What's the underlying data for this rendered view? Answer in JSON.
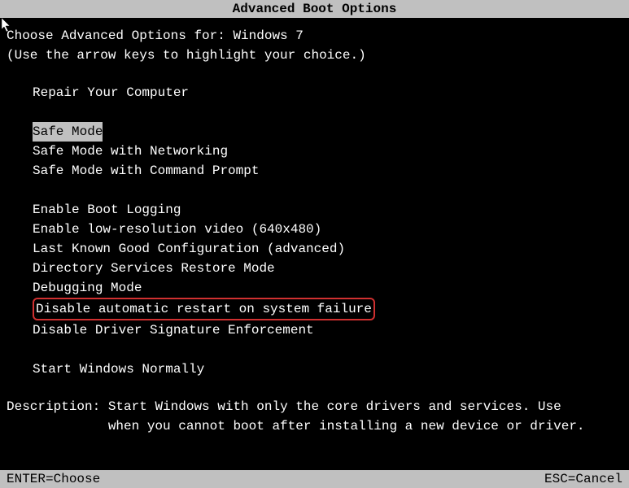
{
  "title": "Advanced Boot Options",
  "instruction1": "Choose Advanced Options for: Windows 7",
  "instruction2": "(Use the arrow keys to highlight your choice.)",
  "menu": {
    "repair": "Repair Your Computer",
    "safe_mode": "Safe Mode",
    "safe_mode_net": "Safe Mode with Networking",
    "safe_mode_cmd": "Safe Mode with Command Prompt",
    "boot_logging": "Enable Boot Logging",
    "low_res": "Enable low-resolution video (640x480)",
    "last_known": "Last Known Good Configuration (advanced)",
    "ds_restore": "Directory Services Restore Mode",
    "debugging": "Debugging Mode",
    "disable_restart": "Disable automatic restart on system failure",
    "disable_sig": "Disable Driver Signature Enforcement",
    "start_normal": "Start Windows Normally"
  },
  "description_label": "Description: ",
  "description_line1": "Start Windows with only the core drivers and services. Use",
  "description_line2": "             when you cannot boot after installing a new device or driver.",
  "footer": {
    "enter": "ENTER=Choose",
    "esc": "ESC=Cancel"
  }
}
